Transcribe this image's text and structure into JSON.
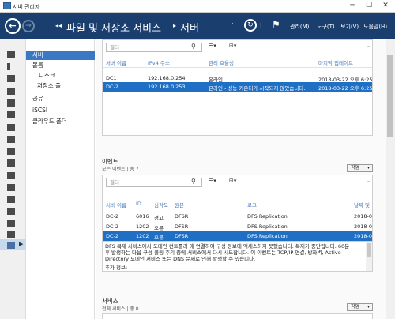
{
  "window": {
    "title": "서버 관리자"
  },
  "header": {
    "breadcrumb": [
      "파일 및 저장소 서비스",
      "서버"
    ],
    "menus": [
      "관리(M)",
      "도구(T)",
      "보기(V)",
      "도움말(H)"
    ]
  },
  "nav": {
    "items": [
      {
        "label": "서버",
        "selected": true,
        "indent": 0
      },
      {
        "label": "볼륨",
        "selected": false,
        "indent": 0
      },
      {
        "label": "디스크",
        "selected": false,
        "indent": 1
      },
      {
        "label": "저장소 풀",
        "selected": false,
        "indent": 1
      },
      {
        "label": "공유",
        "selected": false,
        "indent": 0
      },
      {
        "label": "iSCSI",
        "selected": false,
        "indent": 0
      },
      {
        "label": "클라우드 폴더",
        "selected": false,
        "indent": 0
      }
    ]
  },
  "servers": {
    "filter_placeholder": "필터",
    "columns": [
      "서버 이름",
      "IPv4 주소",
      "관리 효율성",
      "마지막 업데이트"
    ],
    "rows": [
      {
        "name": "DC1",
        "ip": "192.168.0.254",
        "status": "온라인",
        "updated": "2018-03-22 오후 6:25:13"
      },
      {
        "name": "DC-2",
        "ip": "192.168.0.253",
        "status": "온라인 - 성능 카운터가 시작되지 않았습니다.",
        "updated": "2018-03-22 오후 6:25:14"
      }
    ]
  },
  "events": {
    "title": "이벤트",
    "subtitle": "모든 이벤트 | 총 7",
    "task_label": "작업",
    "filter_placeholder": "필터",
    "columns": [
      "서버 이름",
      "ID",
      "심각도",
      "원본",
      "로그",
      "날짜 및"
    ],
    "rows": [
      {
        "server": "DC-2",
        "id": "6016",
        "severity": "경고",
        "source": "DFSR",
        "log": "DFS Replication",
        "date": "2018-0"
      },
      {
        "server": "DC-2",
        "id": "1202",
        "severity": "오류",
        "source": "DFSR",
        "log": "DFS Replication",
        "date": "2018-0"
      },
      {
        "server": "DC-2",
        "id": "1202",
        "severity": "오류",
        "source": "DFSR",
        "log": "DFS Replication",
        "date": "2018-0"
      }
    ],
    "detail_lines": [
      "DFS 복제 서비스에서 도메인 컨트롤러 에 연결하여 구성 정보에 액세스하지 못했습니다. 복제가 중단됩니다. 60분",
      "후 발생하는 다음 구성 폴링 주기 중에 서비스에서 다시 시도합니다. 이 이벤트는 TCP/IP 연결, 방화벽, Active",
      "Directory 도메인 서비스 또는 DNS 문제로 인해 발생할 수 있습니다.",
      "추가 정보:"
    ]
  },
  "services": {
    "title": "서비스",
    "subtitle": "전체 서비스 | 총 0",
    "task_label": "작업"
  },
  "colors": {
    "header": "#1a3f6e",
    "selection": "#1f6fc4",
    "accent_text": "#4a7ab8"
  }
}
